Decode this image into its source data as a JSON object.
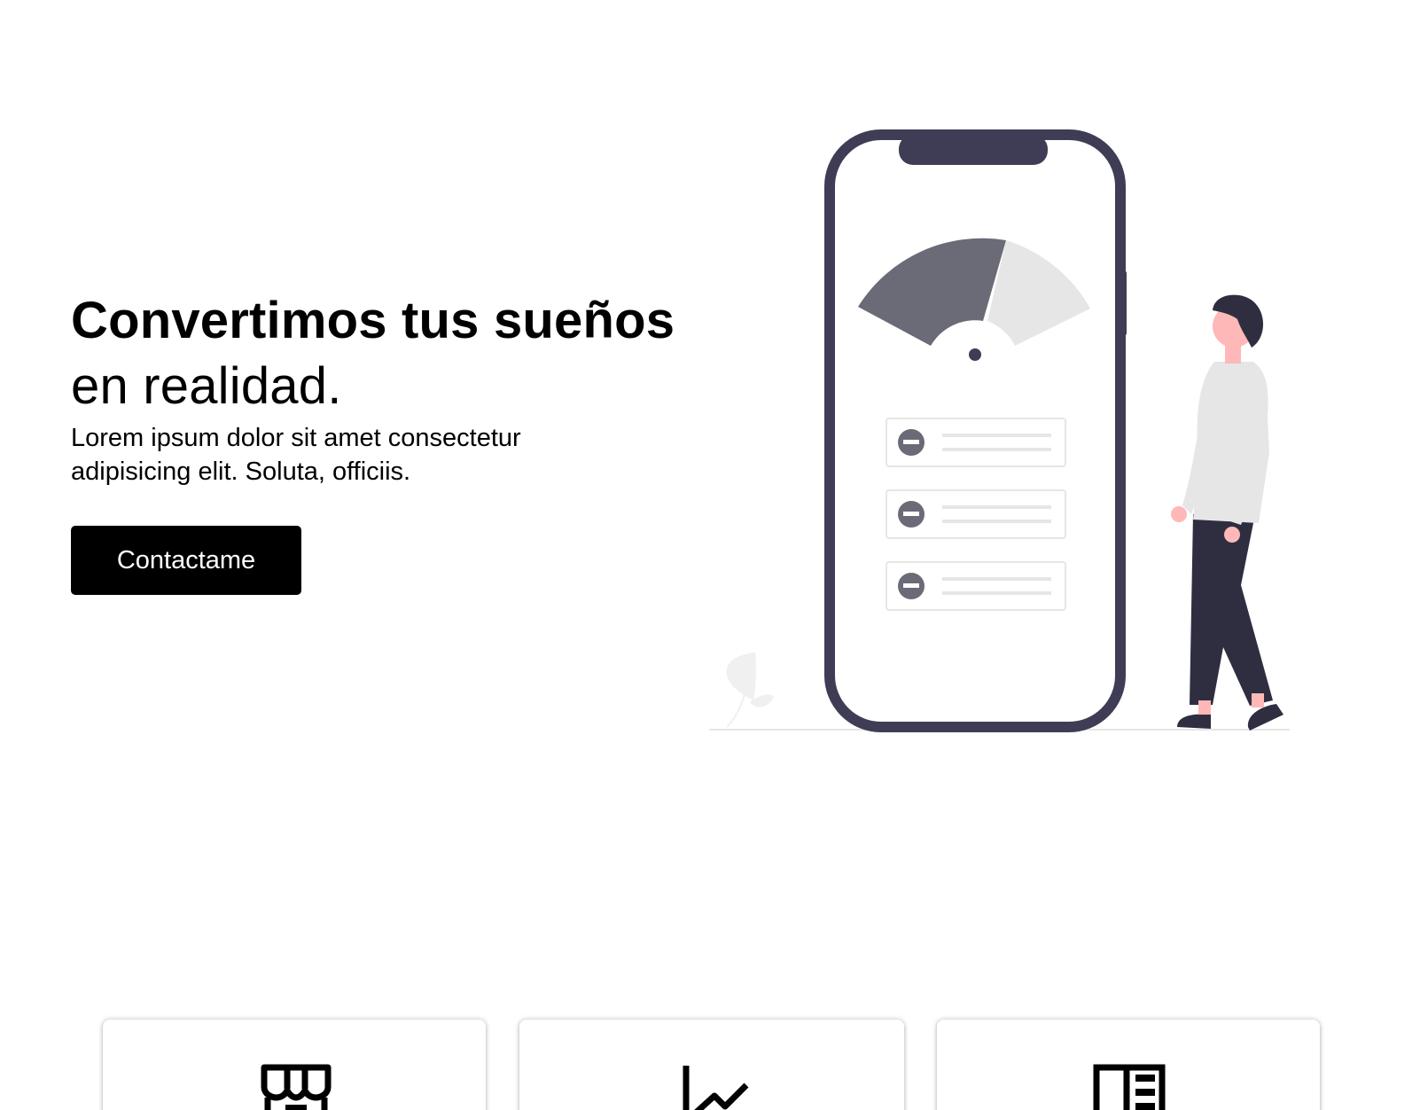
{
  "hero": {
    "title_bold": "Convertimos tus sueños",
    "title_regular": "en realidad.",
    "description": "Lorem ipsum dolor sit amet consectetur adipisicing elit. Soluta, officiis.",
    "cta_label": "Contactame"
  },
  "illustration": {
    "phone_frame_color": "#3f3d56",
    "gauge_dark_color": "#6b6a77",
    "gauge_light_color": "#e6e6e6",
    "person_shirt_color": "#e6e6e6",
    "person_pants_color": "#2f2e41",
    "skin_color": "#ffb8b8"
  },
  "services": {
    "cards": [
      {
        "icon": "storefront-icon"
      },
      {
        "icon": "chart-line-icon"
      },
      {
        "icon": "newspaper-icon"
      }
    ]
  }
}
